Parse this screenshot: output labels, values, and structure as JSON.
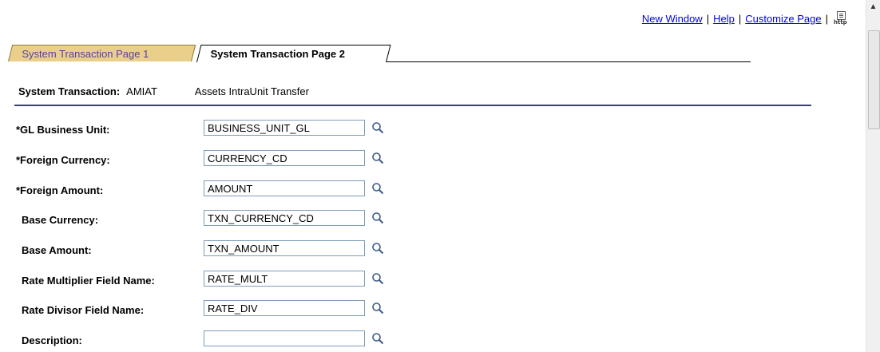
{
  "toplinks": {
    "new_window": "New Window",
    "help": "Help",
    "customize_page": "Customize Page",
    "sep": "|",
    "http_icon_label": "http"
  },
  "tabs": [
    {
      "label": "System Transaction Page 1",
      "active": false
    },
    {
      "label": "System Transaction Page 2",
      "active": true
    }
  ],
  "header": {
    "label": "System Transaction:",
    "code": "AMIAT",
    "description": "Assets IntraUnit Transfer"
  },
  "fields": [
    {
      "label": "*GL Business Unit:",
      "value": "BUSINESS_UNIT_GL"
    },
    {
      "label": "*Foreign Currency:",
      "value": "CURRENCY_CD"
    },
    {
      "label": "*Foreign Amount:",
      "value": "AMOUNT"
    },
    {
      "label": "Base Currency:",
      "value": "TXN_CURRENCY_CD"
    },
    {
      "label": "Base Amount:",
      "value": "TXN_AMOUNT"
    },
    {
      "label": "Rate Multiplier Field Name:",
      "value": "RATE_MULT"
    },
    {
      "label": "Rate Divisor Field Name:",
      "value": "RATE_DIV"
    },
    {
      "label": "Description:",
      "value": ""
    }
  ],
  "icons": {
    "lookup": "magnifier-icon",
    "http": "http-page-icon"
  },
  "colors": {
    "link": "#0000ee",
    "tab_inactive": "#e9cf8a",
    "rule": "#3a3a8c",
    "inactive_tab_text": "#5a3fa0"
  }
}
